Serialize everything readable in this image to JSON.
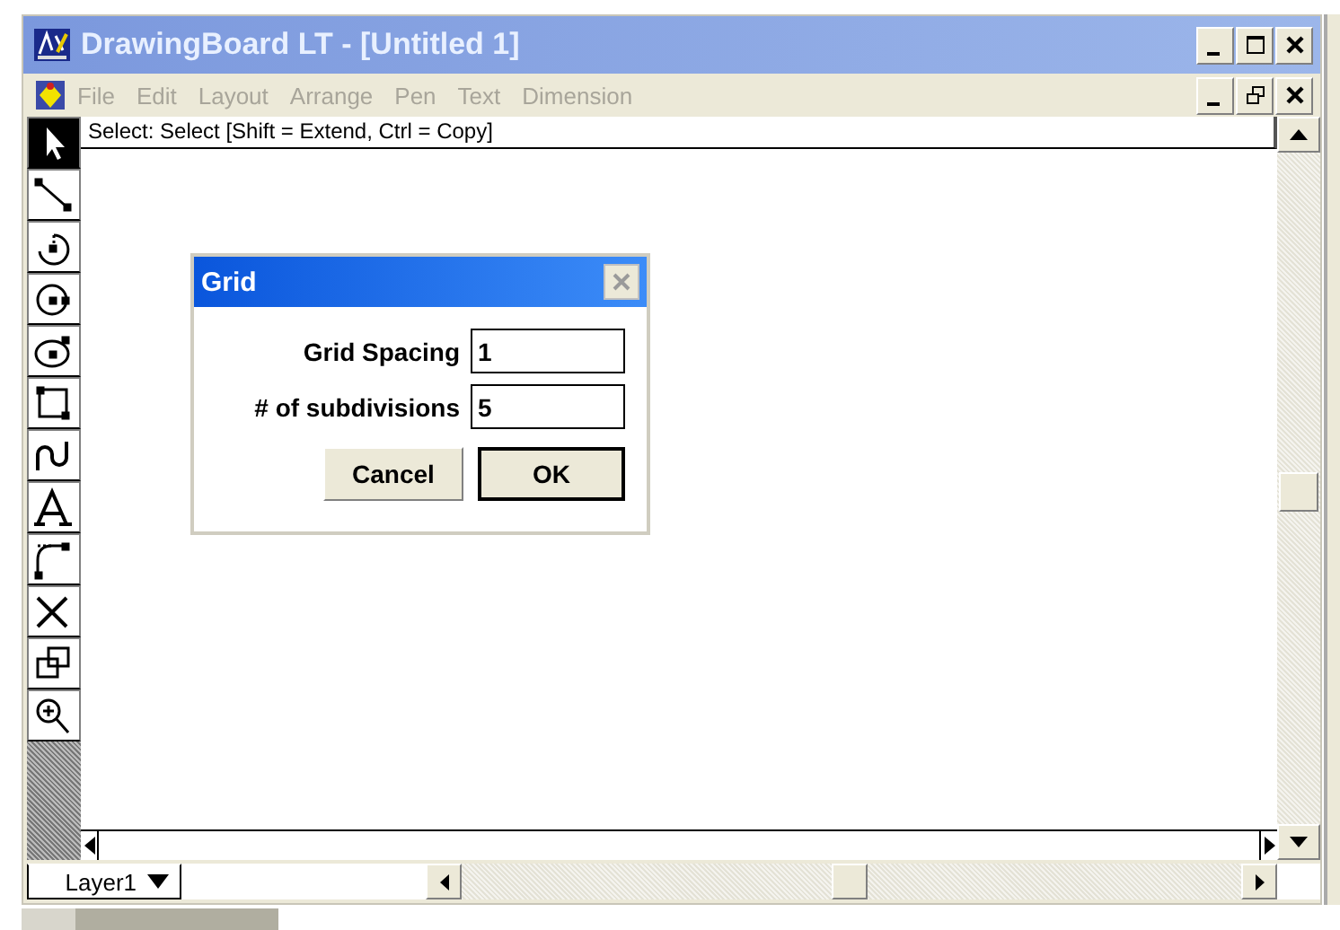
{
  "window": {
    "title": "DrawingBoard LT - [Untitled 1]"
  },
  "menu": [
    {
      "label": "File",
      "disabled": true
    },
    {
      "label": "Edit",
      "disabled": true
    },
    {
      "label": "Layout",
      "disabled": true
    },
    {
      "label": "Arrange",
      "disabled": true
    },
    {
      "label": "Pen",
      "disabled": true
    },
    {
      "label": "Text",
      "disabled": true
    },
    {
      "label": "Dimension",
      "disabled": true
    }
  ],
  "status": "Select: Select  [Shift = Extend, Ctrl = Copy]",
  "tools": [
    {
      "selected": true
    },
    {
      "selected": false
    },
    {
      "selected": false
    },
    {
      "selected": false
    },
    {
      "selected": false
    },
    {
      "selected": false
    },
    {
      "selected": false
    },
    {
      "selected": false
    },
    {
      "selected": false
    },
    {
      "selected": false
    },
    {
      "selected": false
    },
    {
      "selected": false
    }
  ],
  "layer": {
    "value": "Layer1"
  },
  "dialog": {
    "title": "Grid",
    "fields": [
      {
        "label": "Grid Spacing",
        "value": "1"
      },
      {
        "label": "# of subdivisions",
        "value": "5"
      }
    ],
    "buttons": [
      {
        "label": "Cancel",
        "default": false
      },
      {
        "label": "OK",
        "default": true
      }
    ]
  }
}
